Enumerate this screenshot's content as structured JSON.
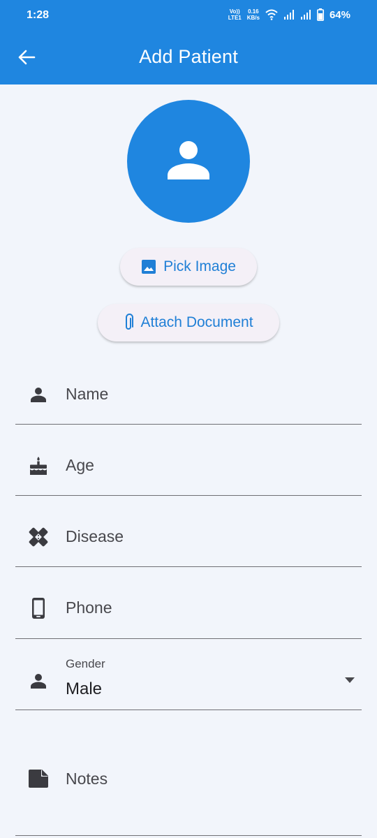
{
  "status_bar": {
    "time": "1:28",
    "volte_label": "Vo))",
    "lte_label": "LTE1",
    "speed_value": "0.16",
    "speed_unit": "KB/s",
    "battery_percent": "64%"
  },
  "header": {
    "title": "Add Patient",
    "color": "#1f86e0"
  },
  "avatar": {
    "icon": "person-icon"
  },
  "actions": {
    "pick_image_label": "Pick Image",
    "attach_document_label": "Attach Document"
  },
  "form": {
    "fields": [
      {
        "label": "Name",
        "icon": "person-icon"
      },
      {
        "label": "Age",
        "icon": "cake-icon"
      },
      {
        "label": "Disease",
        "icon": "healing-icon"
      },
      {
        "label": "Phone",
        "icon": "phone-icon"
      },
      {
        "label": "Gender",
        "value": "Male",
        "icon": "person-icon"
      },
      {
        "label": "Notes",
        "icon": "note-icon"
      }
    ]
  },
  "colors": {
    "accent": "#1f86e0",
    "button_text": "#1f7fd6",
    "background": "#f2f5fb"
  }
}
